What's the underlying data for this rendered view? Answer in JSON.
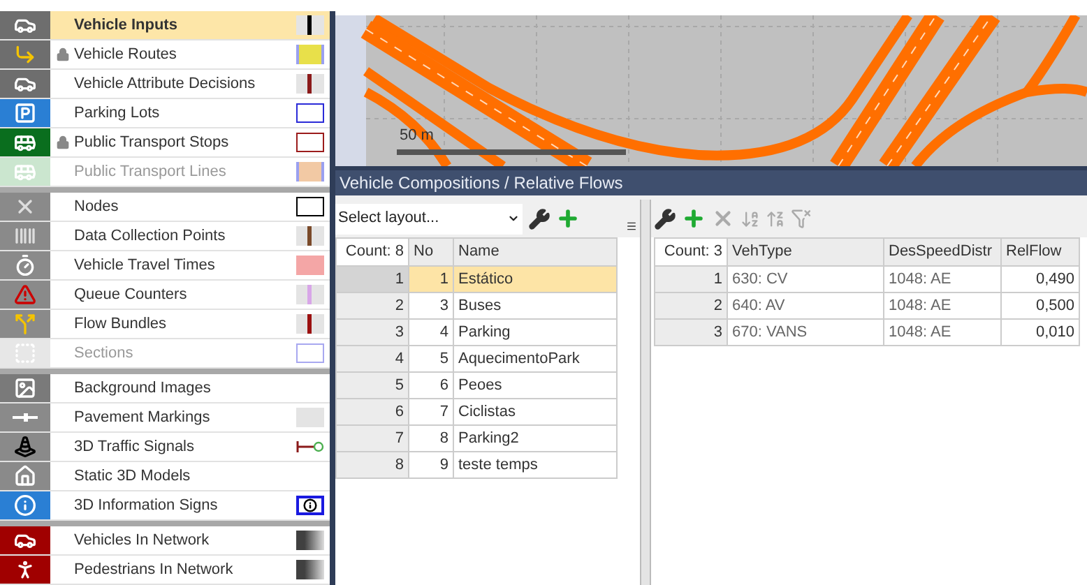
{
  "layers": [
    [
      {
        "label": "Vehicle Inputs",
        "selected": true,
        "locked": false,
        "disabled": false,
        "swatch": {
          "kind": "line",
          "color": "#000000"
        }
      },
      {
        "label": "Vehicle Routes",
        "selected": false,
        "locked": true,
        "disabled": false,
        "swatch": {
          "kind": "fill",
          "color": "#e8e04a"
        }
      },
      {
        "label": "Vehicle Attribute Decisions",
        "selected": false,
        "locked": false,
        "disabled": false,
        "swatch": {
          "kind": "line",
          "color": "#8b1a1a"
        }
      },
      {
        "label": "Parking Lots",
        "selected": false,
        "locked": false,
        "disabled": false,
        "swatch": {
          "kind": "box",
          "color": "#2b2bd8"
        }
      },
      {
        "label": "Public Transport Stops",
        "selected": false,
        "locked": true,
        "disabled": false,
        "swatch": {
          "kind": "box",
          "color": "#9b1c1c"
        }
      },
      {
        "label": "Public Transport Lines",
        "selected": false,
        "locked": false,
        "disabled": true,
        "swatch": {
          "kind": "fill",
          "color": "#f2c9a4"
        }
      }
    ],
    [
      {
        "label": "Nodes",
        "selected": false,
        "locked": false,
        "disabled": false,
        "swatch": {
          "kind": "box",
          "color": "#000000"
        }
      },
      {
        "label": "Data Collection Points",
        "selected": false,
        "locked": false,
        "disabled": false,
        "swatch": {
          "kind": "line",
          "color": "#7a4a2a"
        }
      },
      {
        "label": "Vehicle Travel Times",
        "selected": false,
        "locked": false,
        "disabled": false,
        "swatch": {
          "kind": "plain",
          "color": "#f4a6a6"
        }
      },
      {
        "label": "Queue Counters",
        "selected": false,
        "locked": false,
        "disabled": false,
        "swatch": {
          "kind": "line",
          "color": "#d8a6e8"
        }
      },
      {
        "label": "Flow Bundles",
        "selected": false,
        "locked": false,
        "disabled": false,
        "swatch": {
          "kind": "line",
          "color": "#9b1010"
        }
      },
      {
        "label": "Sections",
        "selected": false,
        "locked": false,
        "disabled": true,
        "swatch": {
          "kind": "box",
          "color": "#a8a8f0"
        }
      }
    ],
    [
      {
        "label": "Background Images",
        "selected": false,
        "locked": false,
        "disabled": false
      },
      {
        "label": "Pavement Markings",
        "selected": false,
        "locked": false,
        "disabled": false,
        "swatch": {
          "kind": "plain",
          "color": "#e4e4e4"
        }
      },
      {
        "label": "3D Traffic Signals",
        "selected": false,
        "locked": false,
        "disabled": false,
        "swatch": {
          "kind": "signal",
          "color": "#8b1a1a"
        }
      },
      {
        "label": "Static 3D Models",
        "selected": false,
        "locked": false,
        "disabled": false
      },
      {
        "label": "3D Information Signs",
        "selected": false,
        "locked": false,
        "disabled": false,
        "swatch": {
          "kind": "info",
          "color": "#1a1ae0"
        }
      }
    ],
    [
      {
        "label": "Vehicles In Network",
        "selected": false,
        "locked": false,
        "disabled": false,
        "swatch": {
          "kind": "gradient",
          "color": "#404040"
        }
      },
      {
        "label": "Pedestrians In Network",
        "selected": false,
        "locked": false,
        "disabled": false,
        "swatch": {
          "kind": "gradient",
          "color": "#404040"
        }
      }
    ]
  ],
  "map": {
    "scale_label": "50 m"
  },
  "panel": {
    "title": "Vehicle Compositions / Relative Flows",
    "layout_select": {
      "value": "Select layout..."
    },
    "compositions": {
      "columns": [
        "Count: 8",
        "No",
        "Name"
      ],
      "rows": [
        {
          "cells": [
            "1",
            "1",
            "Estático"
          ],
          "selected": true
        },
        {
          "cells": [
            "2",
            "3",
            "Buses"
          ],
          "selected": false
        },
        {
          "cells": [
            "3",
            "4",
            "Parking"
          ],
          "selected": false
        },
        {
          "cells": [
            "4",
            "5",
            "AquecimentoPark"
          ],
          "selected": false
        },
        {
          "cells": [
            "5",
            "6",
            "Peoes"
          ],
          "selected": false
        },
        {
          "cells": [
            "6",
            "7",
            "Ciclistas"
          ],
          "selected": false
        },
        {
          "cells": [
            "7",
            "8",
            "Parking2"
          ],
          "selected": false
        },
        {
          "cells": [
            "8",
            "9",
            "teste temps"
          ],
          "selected": false
        }
      ]
    },
    "flows": {
      "columns": [
        "Count: 3",
        "VehType",
        "DesSpeedDistr",
        "RelFlow"
      ],
      "rows": [
        {
          "cells": [
            "1",
            "630: CV",
            "1048: AE",
            "0,490"
          ]
        },
        {
          "cells": [
            "2",
            "640: AV",
            "1048: AE",
            "0,500"
          ]
        },
        {
          "cells": [
            "3",
            "670: VANS",
            "1048: AE",
            "0,010"
          ]
        }
      ]
    }
  }
}
